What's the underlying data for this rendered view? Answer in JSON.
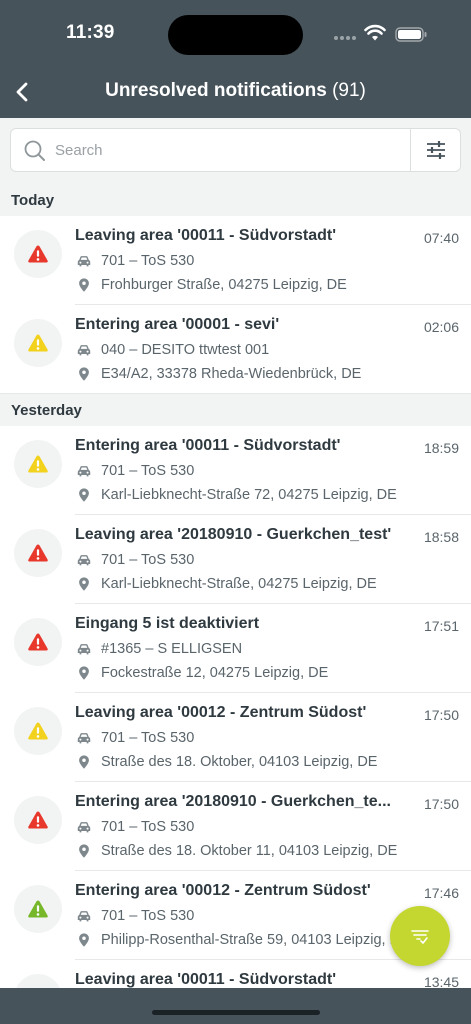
{
  "status_bar": {
    "time": "11:39"
  },
  "nav": {
    "title": "Unresolved notifications",
    "count": "(91)"
  },
  "search": {
    "placeholder": "Search"
  },
  "colors": {
    "red": "#e8382c",
    "yellow": "#f2d21d",
    "green": "#76b82a",
    "header": "#46535b",
    "fab": "#c4d630"
  },
  "sections": [
    {
      "label": "Today",
      "items": [
        {
          "severity": "red",
          "title": "Leaving area '00011 - Südvorstadt'",
          "time": "07:40",
          "vehicle": "701 – ToS 530",
          "address": "Frohburger Straße, 04275 Leipzig, DE"
        },
        {
          "severity": "yellow",
          "title": "Entering area '00001 - sevi'",
          "time": "02:06",
          "vehicle": "040 – DESITO ttwtest 001",
          "address": "E34/A2, 33378 Rheda-Wiedenbrück, DE"
        }
      ]
    },
    {
      "label": "Yesterday",
      "items": [
        {
          "severity": "yellow",
          "title": "Entering area '00011 - Südvorstadt'",
          "time": "18:59",
          "vehicle": "701 – ToS 530",
          "address": "Karl-Liebknecht-Straße 72, 04275 Leipzig, DE"
        },
        {
          "severity": "red",
          "title": "Leaving area '20180910 - Guerkchen_test'",
          "time": "18:58",
          "vehicle": "701 – ToS 530",
          "address": "Karl-Liebknecht-Straße, 04275 Leipzig, DE"
        },
        {
          "severity": "red",
          "title": "Eingang 5 ist deaktiviert",
          "time": "17:51",
          "vehicle": "#1365 – S ELLIGSEN",
          "address": "Fockestraße 12, 04275 Leipzig, DE"
        },
        {
          "severity": "yellow",
          "title": "Leaving area '00012 - Zentrum Südost'",
          "time": "17:50",
          "vehicle": "701 – ToS 530",
          "address": "Straße des 18. Oktober, 04103 Leipzig, DE"
        },
        {
          "severity": "red",
          "title": "Entering area '20180910 - Guerkchen_te...",
          "time": "17:50",
          "vehicle": "701 – ToS 530",
          "address": "Straße des 18. Oktober 11, 04103 Leipzig, DE"
        },
        {
          "severity": "green",
          "title": "Entering area '00012 - Zentrum Südost'",
          "time": "17:46",
          "vehicle": "701 – ToS 530",
          "address": "Philipp-Rosenthal-Straße 59, 04103 Leipzig, DE"
        },
        {
          "severity": "yellow",
          "title": "Leaving area '00011 - Südvorstadt'",
          "time": "13:45",
          "vehicle": "",
          "address": ""
        }
      ]
    }
  ]
}
